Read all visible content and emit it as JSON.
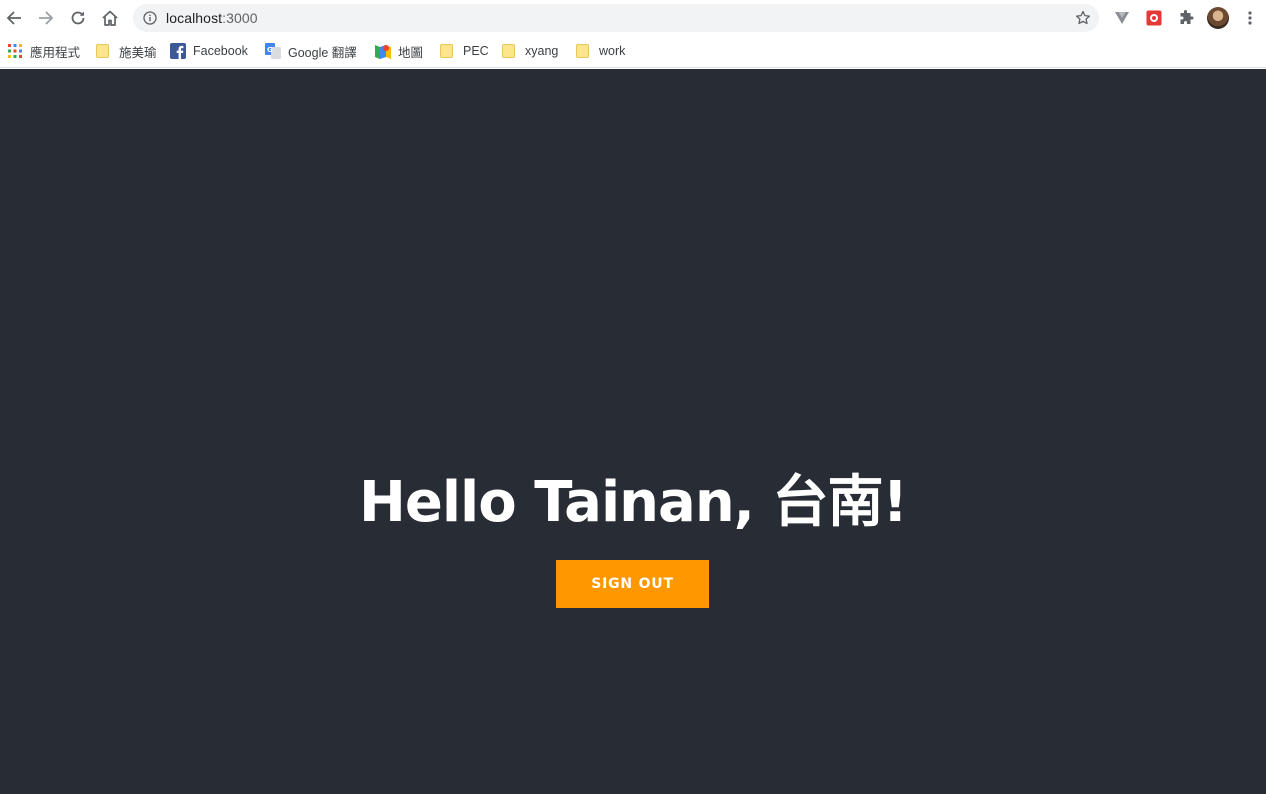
{
  "browser": {
    "url_host": "localhost",
    "url_port": ":3000",
    "bookmarks": [
      {
        "label": "應用程式",
        "icon": "apps-grid-icon"
      },
      {
        "label": "施美瑜",
        "icon": "folder-icon"
      },
      {
        "label": "Facebook",
        "icon": "facebook-icon"
      },
      {
        "label": "Google 翻譯",
        "icon": "google-translate-icon"
      },
      {
        "label": "地圖",
        "icon": "google-maps-icon"
      },
      {
        "label": "PEC",
        "icon": "folder-icon"
      },
      {
        "label": "xyang",
        "icon": "folder-icon"
      },
      {
        "label": "work",
        "icon": "folder-icon"
      }
    ]
  },
  "page": {
    "greeting": "Hello Tainan, 台南!",
    "sign_out_label": "SIGN OUT"
  },
  "colors": {
    "page_background": "#282c34",
    "button_background": "#ff9800",
    "button_text": "#ffffff",
    "heading_text": "#ffffff"
  }
}
